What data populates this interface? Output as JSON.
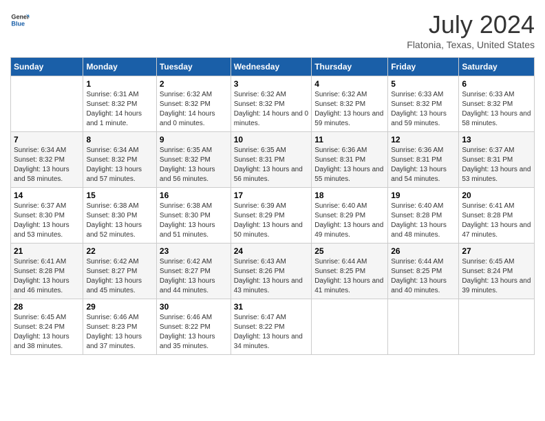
{
  "logo": {
    "text_general": "General",
    "text_blue": "Blue"
  },
  "header": {
    "month_year": "July 2024",
    "location": "Flatonia, Texas, United States"
  },
  "days_of_week": [
    "Sunday",
    "Monday",
    "Tuesday",
    "Wednesday",
    "Thursday",
    "Friday",
    "Saturday"
  ],
  "weeks": [
    [
      {
        "day": "",
        "sunrise": "",
        "sunset": "",
        "daylight": ""
      },
      {
        "day": "1",
        "sunrise": "Sunrise: 6:31 AM",
        "sunset": "Sunset: 8:32 PM",
        "daylight": "Daylight: 14 hours and 1 minute."
      },
      {
        "day": "2",
        "sunrise": "Sunrise: 6:32 AM",
        "sunset": "Sunset: 8:32 PM",
        "daylight": "Daylight: 14 hours and 0 minutes."
      },
      {
        "day": "3",
        "sunrise": "Sunrise: 6:32 AM",
        "sunset": "Sunset: 8:32 PM",
        "daylight": "Daylight: 14 hours and 0 minutes."
      },
      {
        "day": "4",
        "sunrise": "Sunrise: 6:32 AM",
        "sunset": "Sunset: 8:32 PM",
        "daylight": "Daylight: 13 hours and 59 minutes."
      },
      {
        "day": "5",
        "sunrise": "Sunrise: 6:33 AM",
        "sunset": "Sunset: 8:32 PM",
        "daylight": "Daylight: 13 hours and 59 minutes."
      },
      {
        "day": "6",
        "sunrise": "Sunrise: 6:33 AM",
        "sunset": "Sunset: 8:32 PM",
        "daylight": "Daylight: 13 hours and 58 minutes."
      }
    ],
    [
      {
        "day": "7",
        "sunrise": "Sunrise: 6:34 AM",
        "sunset": "Sunset: 8:32 PM",
        "daylight": "Daylight: 13 hours and 58 minutes."
      },
      {
        "day": "8",
        "sunrise": "Sunrise: 6:34 AM",
        "sunset": "Sunset: 8:32 PM",
        "daylight": "Daylight: 13 hours and 57 minutes."
      },
      {
        "day": "9",
        "sunrise": "Sunrise: 6:35 AM",
        "sunset": "Sunset: 8:32 PM",
        "daylight": "Daylight: 13 hours and 56 minutes."
      },
      {
        "day": "10",
        "sunrise": "Sunrise: 6:35 AM",
        "sunset": "Sunset: 8:31 PM",
        "daylight": "Daylight: 13 hours and 56 minutes."
      },
      {
        "day": "11",
        "sunrise": "Sunrise: 6:36 AM",
        "sunset": "Sunset: 8:31 PM",
        "daylight": "Daylight: 13 hours and 55 minutes."
      },
      {
        "day": "12",
        "sunrise": "Sunrise: 6:36 AM",
        "sunset": "Sunset: 8:31 PM",
        "daylight": "Daylight: 13 hours and 54 minutes."
      },
      {
        "day": "13",
        "sunrise": "Sunrise: 6:37 AM",
        "sunset": "Sunset: 8:31 PM",
        "daylight": "Daylight: 13 hours and 53 minutes."
      }
    ],
    [
      {
        "day": "14",
        "sunrise": "Sunrise: 6:37 AM",
        "sunset": "Sunset: 8:30 PM",
        "daylight": "Daylight: 13 hours and 53 minutes."
      },
      {
        "day": "15",
        "sunrise": "Sunrise: 6:38 AM",
        "sunset": "Sunset: 8:30 PM",
        "daylight": "Daylight: 13 hours and 52 minutes."
      },
      {
        "day": "16",
        "sunrise": "Sunrise: 6:38 AM",
        "sunset": "Sunset: 8:30 PM",
        "daylight": "Daylight: 13 hours and 51 minutes."
      },
      {
        "day": "17",
        "sunrise": "Sunrise: 6:39 AM",
        "sunset": "Sunset: 8:29 PM",
        "daylight": "Daylight: 13 hours and 50 minutes."
      },
      {
        "day": "18",
        "sunrise": "Sunrise: 6:40 AM",
        "sunset": "Sunset: 8:29 PM",
        "daylight": "Daylight: 13 hours and 49 minutes."
      },
      {
        "day": "19",
        "sunrise": "Sunrise: 6:40 AM",
        "sunset": "Sunset: 8:28 PM",
        "daylight": "Daylight: 13 hours and 48 minutes."
      },
      {
        "day": "20",
        "sunrise": "Sunrise: 6:41 AM",
        "sunset": "Sunset: 8:28 PM",
        "daylight": "Daylight: 13 hours and 47 minutes."
      }
    ],
    [
      {
        "day": "21",
        "sunrise": "Sunrise: 6:41 AM",
        "sunset": "Sunset: 8:28 PM",
        "daylight": "Daylight: 13 hours and 46 minutes."
      },
      {
        "day": "22",
        "sunrise": "Sunrise: 6:42 AM",
        "sunset": "Sunset: 8:27 PM",
        "daylight": "Daylight: 13 hours and 45 minutes."
      },
      {
        "day": "23",
        "sunrise": "Sunrise: 6:42 AM",
        "sunset": "Sunset: 8:27 PM",
        "daylight": "Daylight: 13 hours and 44 minutes."
      },
      {
        "day": "24",
        "sunrise": "Sunrise: 6:43 AM",
        "sunset": "Sunset: 8:26 PM",
        "daylight": "Daylight: 13 hours and 43 minutes."
      },
      {
        "day": "25",
        "sunrise": "Sunrise: 6:44 AM",
        "sunset": "Sunset: 8:25 PM",
        "daylight": "Daylight: 13 hours and 41 minutes."
      },
      {
        "day": "26",
        "sunrise": "Sunrise: 6:44 AM",
        "sunset": "Sunset: 8:25 PM",
        "daylight": "Daylight: 13 hours and 40 minutes."
      },
      {
        "day": "27",
        "sunrise": "Sunrise: 6:45 AM",
        "sunset": "Sunset: 8:24 PM",
        "daylight": "Daylight: 13 hours and 39 minutes."
      }
    ],
    [
      {
        "day": "28",
        "sunrise": "Sunrise: 6:45 AM",
        "sunset": "Sunset: 8:24 PM",
        "daylight": "Daylight: 13 hours and 38 minutes."
      },
      {
        "day": "29",
        "sunrise": "Sunrise: 6:46 AM",
        "sunset": "Sunset: 8:23 PM",
        "daylight": "Daylight: 13 hours and 37 minutes."
      },
      {
        "day": "30",
        "sunrise": "Sunrise: 6:46 AM",
        "sunset": "Sunset: 8:22 PM",
        "daylight": "Daylight: 13 hours and 35 minutes."
      },
      {
        "day": "31",
        "sunrise": "Sunrise: 6:47 AM",
        "sunset": "Sunset: 8:22 PM",
        "daylight": "Daylight: 13 hours and 34 minutes."
      },
      {
        "day": "",
        "sunrise": "",
        "sunset": "",
        "daylight": ""
      },
      {
        "day": "",
        "sunrise": "",
        "sunset": "",
        "daylight": ""
      },
      {
        "day": "",
        "sunrise": "",
        "sunset": "",
        "daylight": ""
      }
    ]
  ]
}
